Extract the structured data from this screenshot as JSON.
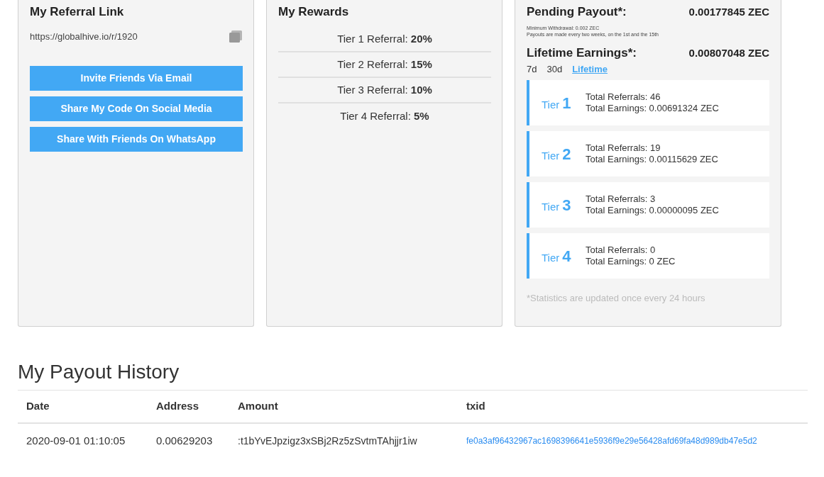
{
  "referral_card": {
    "title": "My Referral Link",
    "link": "https://globalhive.io/r/1920",
    "buttons": [
      "Invite Friends Via Email",
      "Share My Code On Social Media",
      "Share With Friends On WhatsApp"
    ]
  },
  "rewards_card": {
    "title": "My Rewards",
    "tiers": [
      {
        "label": "Tier 1 Referral:",
        "value": "20%"
      },
      {
        "label": "Tier 2 Referral:",
        "value": "15%"
      },
      {
        "label": "Tier 3 Referral:",
        "value": "10%"
      },
      {
        "label": "Tier 4 Referral:",
        "value": "5%"
      }
    ]
  },
  "earnings_card": {
    "pending_label": "Pending Payout*:",
    "pending_value": "0.00177845 ZEC",
    "notes": [
      "Minimum Withdrawal: 0.002 ZEC",
      "Payouts are made every two weeks, on the 1st and the 15th"
    ],
    "lifetime_label": "Lifetime Earnings*:",
    "lifetime_value": "0.00807048 ZEC",
    "periods": [
      {
        "label": "7d",
        "selected": false
      },
      {
        "label": "30d",
        "selected": false
      },
      {
        "label": "Lifetime",
        "selected": true
      }
    ],
    "tiers": [
      {
        "word": "Tier",
        "number": "1",
        "referrals": "Total Referrals: 46",
        "earnings": "Total Earnings: 0.00691324 ZEC"
      },
      {
        "word": "Tier",
        "number": "2",
        "referrals": "Total Referrals: 19",
        "earnings": "Total Earnings: 0.00115629 ZEC"
      },
      {
        "word": "Tier",
        "number": "3",
        "referrals": "Total Referrals: 3",
        "earnings": "Total Earnings: 0.00000095 ZEC"
      },
      {
        "word": "Tier",
        "number": "4",
        "referrals": "Total Referrals: 0",
        "earnings": "Total Earnings: 0 ZEC"
      }
    ],
    "footnote": "*Statistics are updated once every 24 hours"
  },
  "payout_history": {
    "title": "My Payout History",
    "columns": [
      "Date",
      "Address",
      "Amount",
      "txid"
    ],
    "rows": [
      {
        "date": "2020-09-01 01:10:05",
        "address": "0.00629203",
        "amount": ":t1bYvEJpzigz3xSBj2Rz5zSvtmTAhjjr1iw",
        "txid": "fe0a3af96432967ac1698396641e5936f9e29e56428afd69fa48d989db47e5d2"
      }
    ]
  }
}
